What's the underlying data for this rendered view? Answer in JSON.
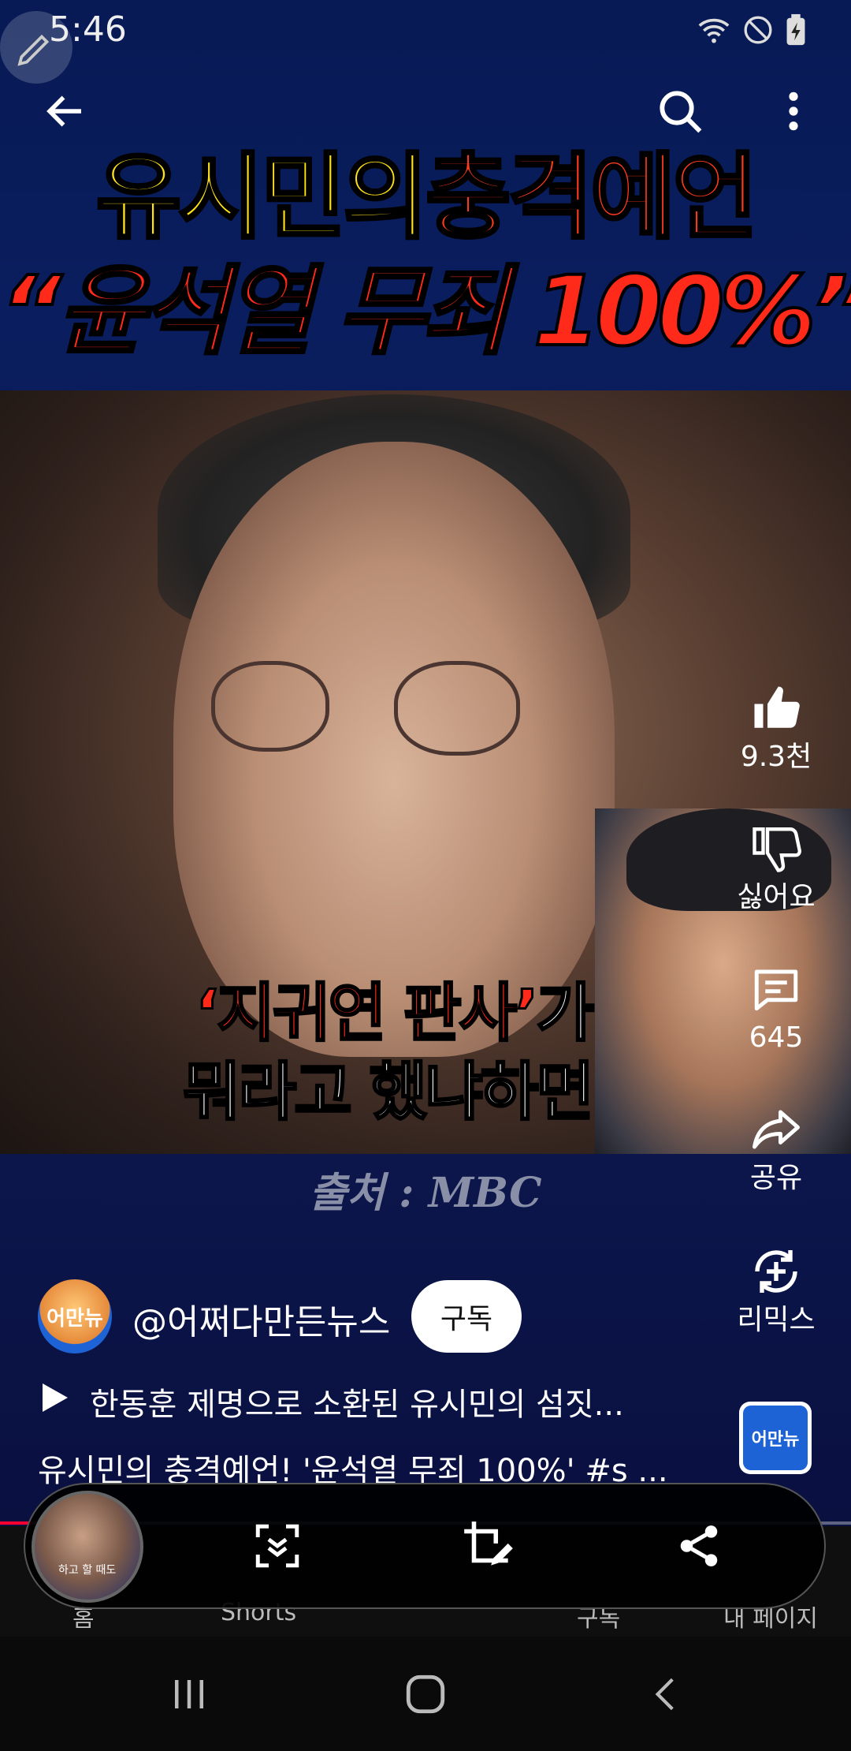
{
  "status_bar": {
    "time": "5:46"
  },
  "video": {
    "headline_part1": "유시민의",
    "headline_part2": "충격예언",
    "headline_line2": "“윤석열 무죄 100%”",
    "caption_quote": "‘지귀연 판사’",
    "caption_suffix": "가",
    "caption_line2": "뭐라고 했냐하면",
    "source_label": "출처 : MBC"
  },
  "rail": {
    "like_count": "9.3천",
    "dislike_label": "싫어요",
    "comment_count": "645",
    "share_label": "공유",
    "remix_label": "리믹스"
  },
  "channel": {
    "avatar_text": "어만뉴",
    "name": "@어쩌다만든뉴스",
    "subscribe_label": "구독"
  },
  "playlist_title": "한동훈 제명으로 소환된 유시민의 섬짓...",
  "description": "유시민의 충격예언! '윤석열 무죄 100%' #s ...",
  "remix_thumb_text": "어만뉴",
  "progress": 0.04,
  "bottom_nav": {
    "home": "홈",
    "shorts": "Shorts",
    "subscriptions": "구독",
    "my_page": "내 페이지"
  },
  "thumb_caption": "하고 할 때도",
  "colors": {
    "accent_red": "#ff0033",
    "headline_yellow": "#ffe21a",
    "headline_red": "#ff2a1a"
  },
  "icons": [
    "pen-icon",
    "wifi-icon",
    "dnd-icon",
    "battery-icon",
    "back-icon",
    "search-icon",
    "more-icon",
    "like-icon",
    "dislike-icon",
    "comment-icon",
    "share-icon",
    "remix-icon",
    "play-icon",
    "scroll-capture-icon",
    "crop-edit-icon",
    "share-capture-icon",
    "recents-icon",
    "home-icon",
    "back-nav-icon"
  ]
}
